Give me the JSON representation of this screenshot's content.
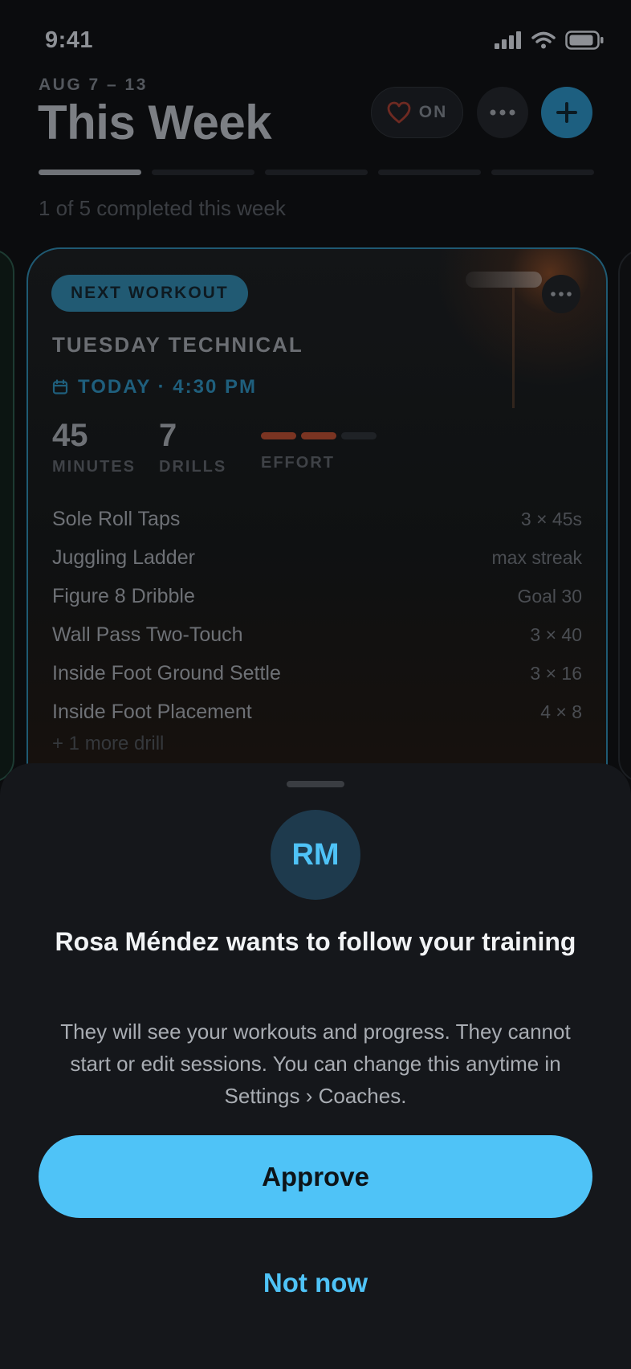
{
  "status_bar": {
    "time": "9:41"
  },
  "header": {
    "week_range": "AUG 7 – 13",
    "title": "This Week",
    "heart_toggle_label": "ON",
    "segments_total": 5,
    "segments_completed": 1,
    "progress_text": "1 of 5 completed this week"
  },
  "card": {
    "badge": "NEXT WORKOUT",
    "title": "TUESDAY TECHNICAL",
    "when": "TODAY · 4:30 PM",
    "minutes_value": "45",
    "minutes_label": "MINUTES",
    "drills_value": "7",
    "drills_label": "DRILLS",
    "effort_label": "EFFORT",
    "effort_level": 2,
    "effort_max": 3,
    "drills": [
      {
        "name": "Sole Roll Taps",
        "value": "3 × 45s"
      },
      {
        "name": "Juggling Ladder",
        "value": "max streak"
      },
      {
        "name": "Figure 8 Dribble",
        "value": "Goal 30"
      },
      {
        "name": "Wall Pass Two-Touch",
        "value": "3 × 40"
      },
      {
        "name": "Inside Foot Ground Settle",
        "value": "3 × 16"
      },
      {
        "name": "Inside Foot Placement",
        "value": "4 × 8"
      }
    ],
    "more_drills": "+ 1 more drill"
  },
  "sheet": {
    "avatar_initials": "RM",
    "title": "Rosa Méndez wants to follow your training",
    "body": "They will see your workouts and progress. They cannot start or edit sessions. You can change this anytime in Settings › Coaches.",
    "approve_label": "Approve",
    "not_now_label": "Not now"
  },
  "colors": {
    "accent": "#4fc3f7",
    "sheet_bg": "#15171b",
    "effort_on": "#7a3422",
    "card_border": "#1f5a73"
  }
}
